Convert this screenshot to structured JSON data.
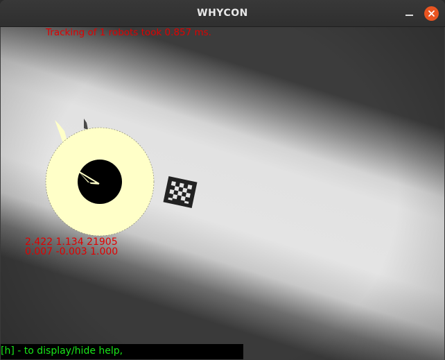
{
  "window": {
    "title": "WHYCON",
    "controls": {
      "minimize_icon": "minimize-icon",
      "close_icon": "close-icon",
      "close_color": "#e95420"
    }
  },
  "overlay": {
    "tracking_status": "Tracking of 1 robots took 0.857 ms.",
    "marker_position": "2.422 1.134 21905",
    "marker_rotation": "0.007 -0.003 1.000",
    "help_hint": "[h] - to display/hide help,"
  },
  "colors": {
    "overlay_text": "#e00000",
    "help_text": "#19e619",
    "marker_fill": "#ffffc8"
  }
}
